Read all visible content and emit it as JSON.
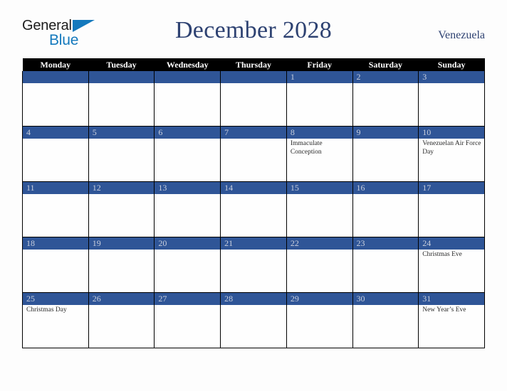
{
  "logo": {
    "word1": "General",
    "word2": "Blue",
    "triangle_color": "#1479bd"
  },
  "header": {
    "title": "December 2028",
    "country": "Venezuela",
    "title_color": "#2e4272"
  },
  "calendar": {
    "weekday_headers": [
      "Monday",
      "Tuesday",
      "Wednesday",
      "Thursday",
      "Friday",
      "Saturday",
      "Sunday"
    ],
    "header_bg": "#000000",
    "daynum_bg": "#2f5597",
    "daynum_color": "#c9cfdd",
    "weeks": [
      [
        {
          "day": "",
          "events": []
        },
        {
          "day": "",
          "events": []
        },
        {
          "day": "",
          "events": []
        },
        {
          "day": "",
          "events": []
        },
        {
          "day": "1",
          "events": []
        },
        {
          "day": "2",
          "events": []
        },
        {
          "day": "3",
          "events": []
        }
      ],
      [
        {
          "day": "4",
          "events": []
        },
        {
          "day": "5",
          "events": []
        },
        {
          "day": "6",
          "events": []
        },
        {
          "day": "7",
          "events": []
        },
        {
          "day": "8",
          "events": [
            "Immaculate Conception"
          ]
        },
        {
          "day": "9",
          "events": []
        },
        {
          "day": "10",
          "events": [
            "Venezuelan Air Force Day"
          ]
        }
      ],
      [
        {
          "day": "11",
          "events": []
        },
        {
          "day": "12",
          "events": []
        },
        {
          "day": "13",
          "events": []
        },
        {
          "day": "14",
          "events": []
        },
        {
          "day": "15",
          "events": []
        },
        {
          "day": "16",
          "events": []
        },
        {
          "day": "17",
          "events": []
        }
      ],
      [
        {
          "day": "18",
          "events": []
        },
        {
          "day": "19",
          "events": []
        },
        {
          "day": "20",
          "events": []
        },
        {
          "day": "21",
          "events": []
        },
        {
          "day": "22",
          "events": []
        },
        {
          "day": "23",
          "events": []
        },
        {
          "day": "24",
          "events": [
            "Christmas Eve"
          ]
        }
      ],
      [
        {
          "day": "25",
          "events": [
            "Christmas Day"
          ]
        },
        {
          "day": "26",
          "events": []
        },
        {
          "day": "27",
          "events": []
        },
        {
          "day": "28",
          "events": []
        },
        {
          "day": "29",
          "events": []
        },
        {
          "day": "30",
          "events": []
        },
        {
          "day": "31",
          "events": [
            "New Year’s Eve"
          ]
        }
      ]
    ]
  }
}
